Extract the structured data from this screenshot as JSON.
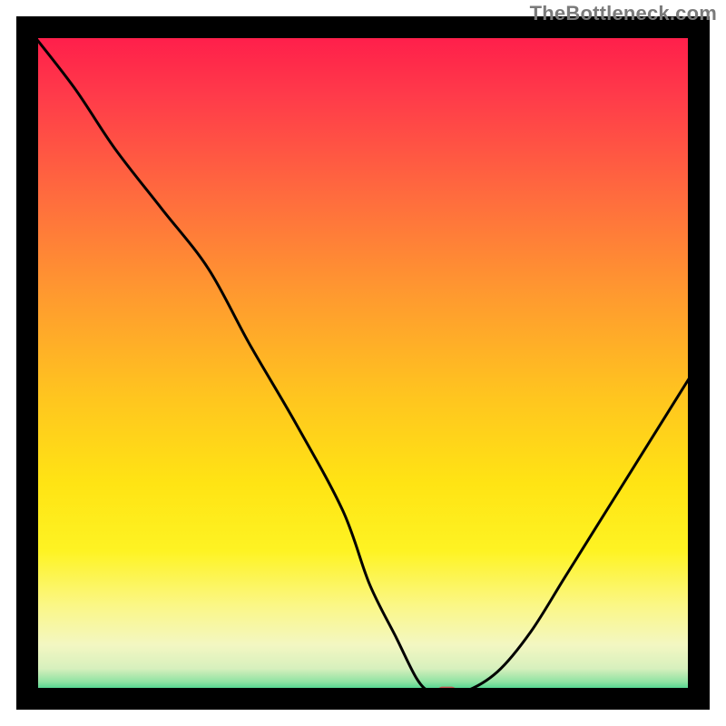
{
  "watermark": "TheBottleneck.com",
  "chart_data": {
    "type": "line",
    "title": "",
    "xlabel": "",
    "ylabel": "",
    "x": [
      0.0,
      0.07,
      0.13,
      0.2,
      0.27,
      0.33,
      0.4,
      0.47,
      0.51,
      0.55,
      0.58,
      0.6,
      0.62,
      0.65,
      0.7,
      0.75,
      0.8,
      0.85,
      0.9,
      0.95,
      1.0
    ],
    "values": [
      100,
      91,
      82,
      73,
      64,
      53,
      41,
      28,
      17,
      9,
      3,
      1,
      1,
      1,
      4,
      10,
      18,
      26,
      34,
      42,
      50
    ],
    "xlim": [
      0,
      1
    ],
    "ylim": [
      0,
      100
    ],
    "minimum_marker": {
      "x": 0.625,
      "y": 1
    },
    "background": "red-to-green-vertical-gradient"
  }
}
